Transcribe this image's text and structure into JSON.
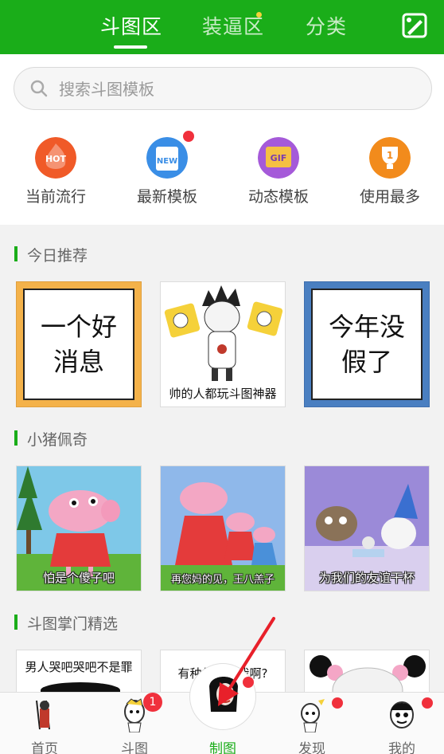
{
  "colors": {
    "brand": "#1aad19",
    "badge": "#f0303c"
  },
  "top_tabs": [
    {
      "label": "斗图区",
      "active": true
    },
    {
      "label": "装逼区",
      "active": false
    },
    {
      "label": "分类",
      "active": false
    }
  ],
  "top_right_icon": "edit-icon",
  "search": {
    "placeholder": "搜索斗图模板",
    "value": ""
  },
  "categories": [
    {
      "label": "当前流行",
      "icon": "hot-icon",
      "icon_text": "HOT",
      "color": "#f05a28"
    },
    {
      "label": "最新模板",
      "icon": "new-icon",
      "icon_text": "NEW",
      "color": "#3a8ee6"
    },
    {
      "label": "动态模板",
      "icon": "gif-icon",
      "icon_text": "GIF",
      "color": "#a55ad9"
    },
    {
      "label": "使用最多",
      "icon": "trophy-icon",
      "icon_text": "1",
      "color": "#f28b1c"
    }
  ],
  "sections": [
    {
      "title": "今日推荐",
      "cards": [
        {
          "text_lines": [
            "一个好",
            "消息"
          ],
          "caption": ""
        },
        {
          "text_lines": [],
          "caption": "帅的人都玩斗图神器"
        },
        {
          "text_lines": [
            "今年没",
            "假了"
          ],
          "caption": ""
        }
      ]
    },
    {
      "title": "小猪佩奇",
      "cards": [
        {
          "caption": "怕是个傻子吧"
        },
        {
          "caption": "再您妈的见，王八羔子"
        },
        {
          "caption": "为我们的友谊干杯"
        }
      ]
    },
    {
      "title": "斗图掌门精选",
      "cards": [
        {
          "caption": "男人哭吧哭吧不是罪"
        },
        {
          "caption": "有种你来打我啊?"
        },
        {
          "caption": ""
        }
      ]
    }
  ],
  "bottom_nav": [
    {
      "label": "首页",
      "active": false,
      "badge": ""
    },
    {
      "label": "斗图",
      "active": false,
      "badge": "1"
    },
    {
      "label": "制图",
      "active": true,
      "badge": ""
    },
    {
      "label": "发现",
      "active": false,
      "badge": ""
    },
    {
      "label": "我的",
      "active": false,
      "badge": ""
    }
  ]
}
